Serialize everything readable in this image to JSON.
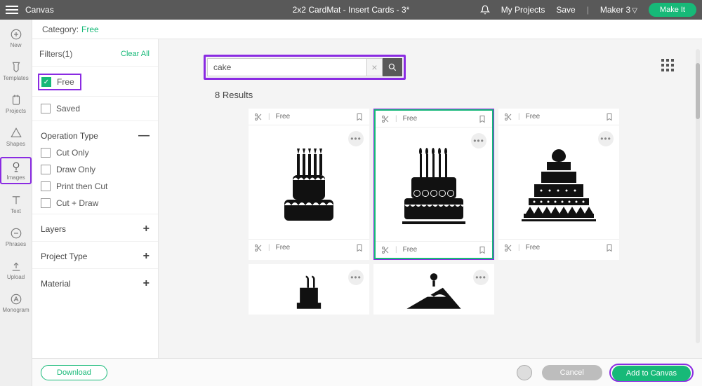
{
  "topbar": {
    "app": "Canvas",
    "project": "2x2 CardMat - Insert Cards - 3*",
    "my_projects": "My Projects",
    "save": "Save",
    "machine": "Maker 3",
    "make_it": "Make It"
  },
  "rail": {
    "new": "New",
    "templates": "Templates",
    "projects": "Projects",
    "shapes": "Shapes",
    "images": "Images",
    "text": "Text",
    "phrases": "Phrases",
    "upload": "Upload",
    "monogram": "Monogram"
  },
  "category": {
    "label": "Category:",
    "value": "Free"
  },
  "filters": {
    "title": "Filters(1)",
    "clear": "Clear All",
    "free": "Free",
    "saved": "Saved",
    "operation_heading": "Operation Type",
    "operations": {
      "cut": "Cut Only",
      "draw": "Draw Only",
      "ptc": "Print then Cut",
      "cd": "Cut + Draw"
    },
    "layers": "Layers",
    "project_type": "Project Type",
    "material": "Material"
  },
  "search": {
    "value": "cake"
  },
  "results": {
    "count_label": "8 Results",
    "tag": "Free"
  },
  "footer": {
    "download": "Download",
    "cancel": "Cancel",
    "add": "Add to Canvas"
  }
}
